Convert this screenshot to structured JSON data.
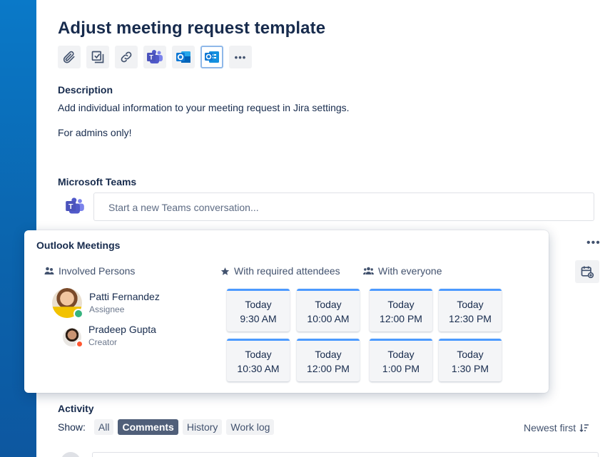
{
  "page": {
    "title": "Adjust meeting request template"
  },
  "toolbar": {
    "buttons": [
      {
        "icon": "paperclip-icon"
      },
      {
        "icon": "checklist-icon"
      },
      {
        "icon": "link-icon"
      },
      {
        "icon": "teams-icon"
      },
      {
        "icon": "outlook-icon"
      },
      {
        "icon": "outlook-meeting-icon",
        "active": true
      },
      {
        "icon": "more-icon",
        "label": "•••"
      }
    ]
  },
  "description": {
    "label": "Description",
    "line1": "Add individual information to your meeting request in Jira settings.",
    "line2": "For admins only!"
  },
  "teams": {
    "label": "Microsoft Teams",
    "placeholder": "Start a new Teams conversation..."
  },
  "right_panel": {
    "more_label": "•••"
  },
  "outlook": {
    "title": "Outlook Meetings",
    "involved_label": "Involved Persons",
    "required_label": "With required attendees",
    "everyone_label": "With everyone",
    "persons": [
      {
        "name": "Patti Fernandez",
        "role": "Assignee",
        "status": "#36b37e"
      },
      {
        "name": "Pradeep Gupta",
        "role": "Creator",
        "status": "#ff5630"
      }
    ],
    "required_slots": [
      {
        "day": "Today",
        "time": "9:30 AM"
      },
      {
        "day": "Today",
        "time": "10:00 AM"
      },
      {
        "day": "Today",
        "time": "10:30 AM"
      },
      {
        "day": "Today",
        "time": "12:00 PM"
      }
    ],
    "everyone_slots": [
      {
        "day": "Today",
        "time": "12:00 PM"
      },
      {
        "day": "Today",
        "time": "12:30 PM"
      },
      {
        "day": "Today",
        "time": "1:00 PM"
      },
      {
        "day": "Today",
        "time": "1:30 PM"
      }
    ],
    "accent_color": "#4c9aff"
  },
  "activity": {
    "label": "Activity",
    "show_label": "Show:",
    "filters": [
      "All",
      "Comments",
      "History",
      "Work log"
    ],
    "selected_filter": "Comments",
    "sort_label": "Newest first"
  }
}
